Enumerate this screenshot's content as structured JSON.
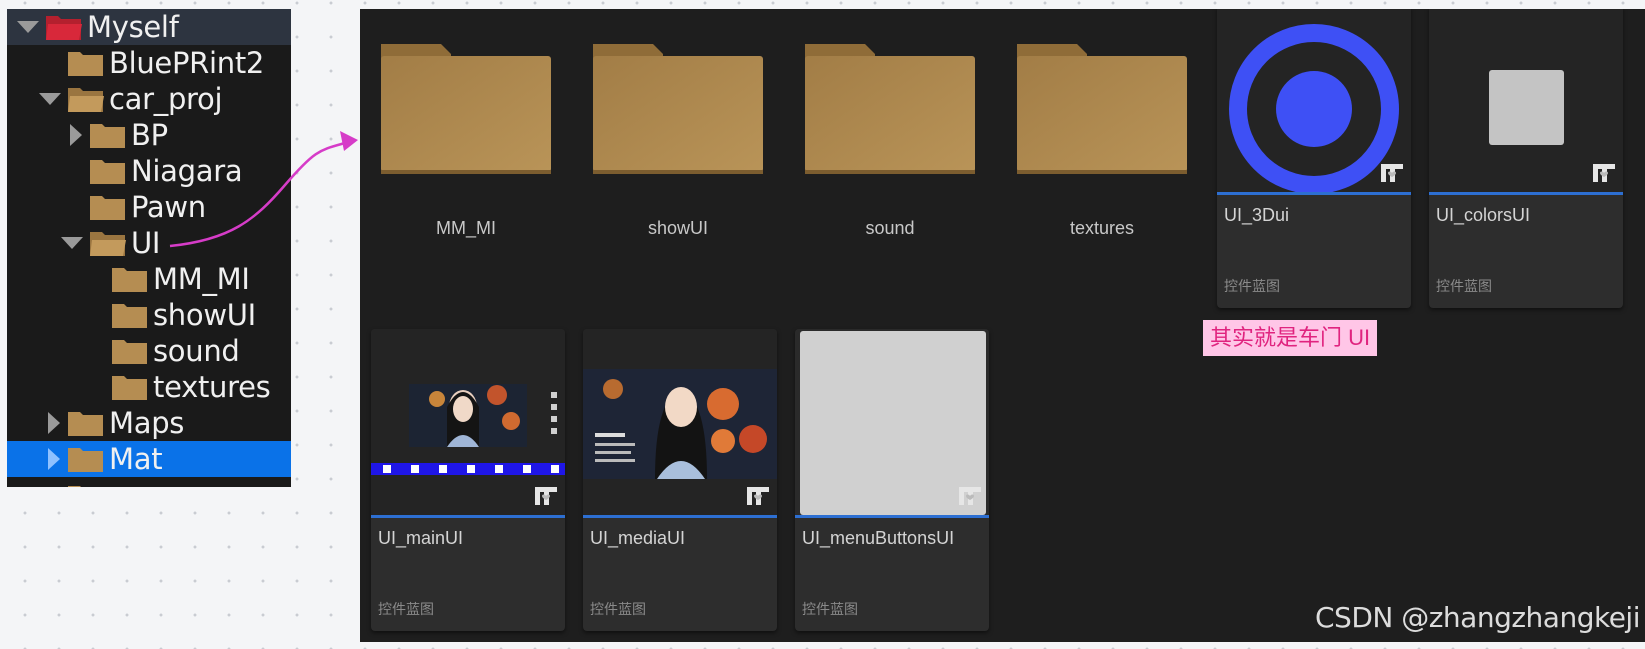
{
  "tree": {
    "items": [
      {
        "label": "Myself",
        "expanded": true,
        "folder_color": "#d8283a"
      },
      {
        "label": "BluePRint2"
      },
      {
        "label": "car_proj",
        "expanded": true
      },
      {
        "label": "BP",
        "collapsed": true
      },
      {
        "label": "Niagara"
      },
      {
        "label": "Pawn"
      },
      {
        "label": "UI",
        "expanded": true
      },
      {
        "label": "MM_MI"
      },
      {
        "label": "showUI"
      },
      {
        "label": "sound"
      },
      {
        "label": "textures"
      },
      {
        "label": "Maps",
        "collapsed": true
      },
      {
        "label": "Mat",
        "collapsed": true,
        "selected": true
      }
    ]
  },
  "browser": {
    "folders": [
      {
        "label": "MM_MI"
      },
      {
        "label": "showUI"
      },
      {
        "label": "sound"
      },
      {
        "label": "textures"
      }
    ],
    "assets": [
      {
        "name": "UI_3Dui",
        "type": "控件蓝图",
        "thumb": "blue-target-icon"
      },
      {
        "name": "UI_colorsUI",
        "type": "控件蓝图",
        "thumb": "gray-square"
      },
      {
        "name": "UI_mainUI",
        "type": "控件蓝图",
        "thumb": "photo-with-blue-bar"
      },
      {
        "name": "UI_mediaUI",
        "type": "控件蓝图",
        "thumb": "photo"
      },
      {
        "name": "UI_menuButtonsUI",
        "type": "控件蓝图",
        "thumb": "light-gray-panel"
      }
    ]
  },
  "annotation": {
    "text": "其实就是车门 UI",
    "color": "#e0247f",
    "background": "#ffc6e7"
  },
  "watermark": {
    "text": "CSDN @zhangzhangkeji"
  },
  "colors": {
    "accent": "#2d6fd2",
    "selection": "#0a72e8",
    "folder": "#b08a50",
    "connector": "#d63cc8"
  }
}
